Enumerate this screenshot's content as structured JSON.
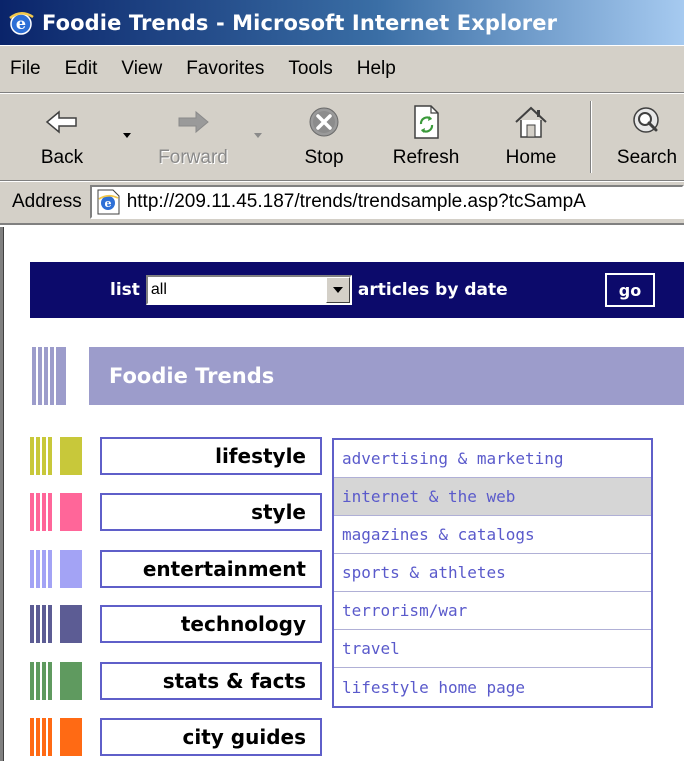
{
  "window": {
    "title": "Foodie Trends - Microsoft Internet Explorer"
  },
  "menu": [
    "File",
    "Edit",
    "View",
    "Favorites",
    "Tools",
    "Help"
  ],
  "toolbar": {
    "back": "Back",
    "forward": "Forward",
    "stop": "Stop",
    "refresh": "Refresh",
    "home": "Home",
    "search": "Search"
  },
  "address": {
    "label": "Address",
    "url": "http://209.11.45.187/trends/trendsample.asp?tcSampA"
  },
  "nav": {
    "list_label": "list",
    "select_value": "all",
    "after_label": "articles by date",
    "go_label": "go"
  },
  "banner": {
    "title": "Foodie Trends"
  },
  "categories": [
    {
      "label": "lifestyle",
      "color": "#c8c83a"
    },
    {
      "label": "style",
      "color": "#ff6699"
    },
    {
      "label": "entertainment",
      "color": "#a3a3f5"
    },
    {
      "label": "technology",
      "color": "#5c5c94"
    },
    {
      "label": "stats & facts",
      "color": "#5f9a5f"
    },
    {
      "label": "city guides",
      "color": "#ff6a14"
    }
  ],
  "submenu": [
    "advertising & marketing",
    "internet & the web",
    "magazines & catalogs",
    "sports & athletes",
    "terrorism/war",
    "travel",
    "lifestyle home page"
  ],
  "colors": {
    "nav_band": "#0c0a6b",
    "banner": "#9c9ccb",
    "link": "#5a5acb",
    "highlight": "#d6d6d6"
  }
}
